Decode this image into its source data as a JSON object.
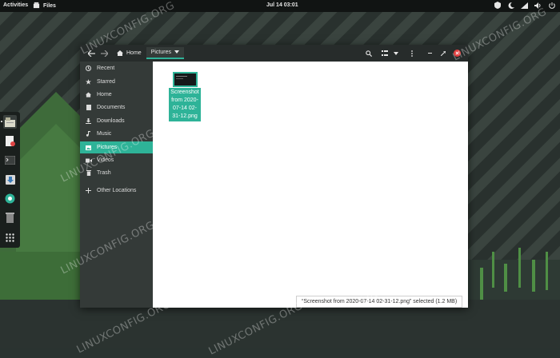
{
  "topbar": {
    "activities": "Activities",
    "app_name": "Files",
    "clock": "Jul 14  03:01"
  },
  "window": {
    "path": {
      "home": "Home",
      "current": "Pictures"
    },
    "sidebar": [
      {
        "icon": "clock-icon",
        "label": "Recent"
      },
      {
        "icon": "star-icon",
        "label": "Starred"
      },
      {
        "icon": "home-icon",
        "label": "Home"
      },
      {
        "icon": "document-icon",
        "label": "Documents"
      },
      {
        "icon": "download-icon",
        "label": "Downloads"
      },
      {
        "icon": "music-icon",
        "label": "Music"
      },
      {
        "icon": "picture-icon",
        "label": "Pictures",
        "active": true
      },
      {
        "icon": "video-icon",
        "label": "Videos"
      },
      {
        "icon": "trash-icon",
        "label": "Trash"
      },
      {
        "icon": "plus-icon",
        "label": "Other Locations"
      }
    ],
    "file": {
      "label": "Screenshot from 2020-07-14 02-31-12.png"
    },
    "status": "“Screenshot from 2020-07-14 02-31-12.png” selected  (1.2 MB)"
  },
  "watermark": "LINUXCONFIG.ORG",
  "colors": {
    "accent": "#2eb398",
    "close": "#e23e3e",
    "wallpaper_green": "#3e7d3c"
  }
}
